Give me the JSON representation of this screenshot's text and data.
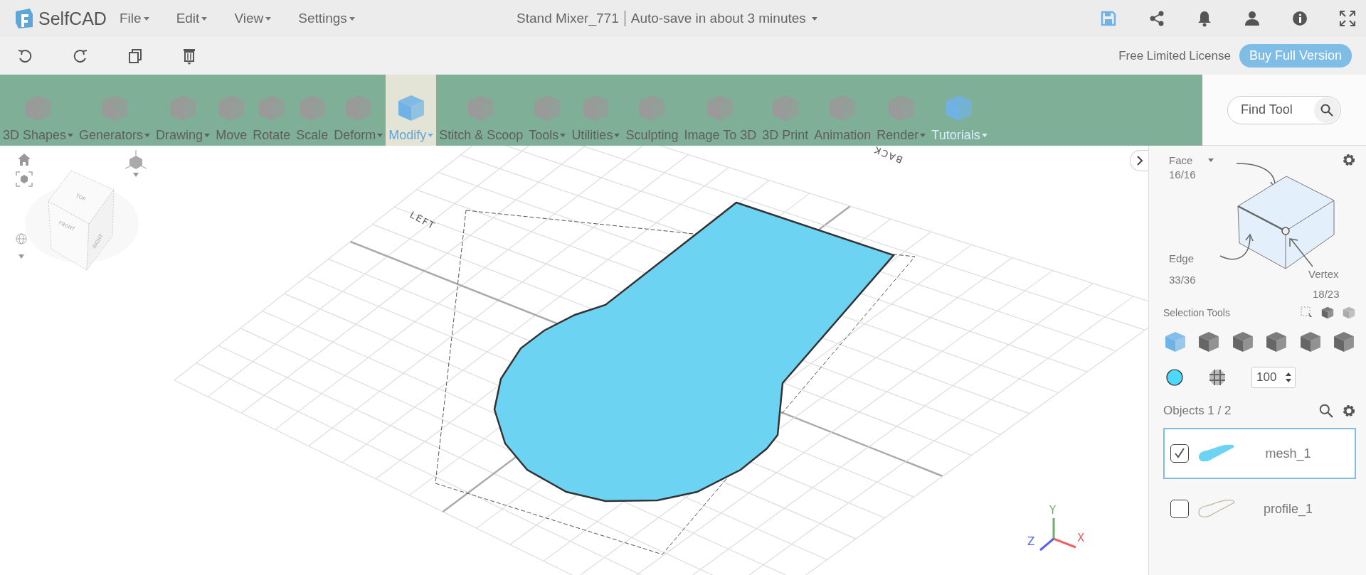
{
  "app": {
    "logo": "SelfCAD",
    "menus": [
      "File",
      "Edit",
      "View",
      "Settings"
    ]
  },
  "document": {
    "title": "Stand Mixer_771",
    "autosave": "Auto-save in about 3 minutes"
  },
  "license": {
    "text": "Free Limited License",
    "button": "Buy Full Version"
  },
  "ribbon": [
    {
      "label": "3D Shapes",
      "dropdown": true,
      "selected": false,
      "kind": "tool"
    },
    {
      "label": "Generators",
      "dropdown": true,
      "selected": false,
      "kind": "tool"
    },
    {
      "label": "Drawing",
      "dropdown": true,
      "selected": false,
      "kind": "tool"
    },
    {
      "label": "Move",
      "dropdown": false,
      "selected": false,
      "kind": "tool"
    },
    {
      "label": "Rotate",
      "dropdown": false,
      "selected": false,
      "kind": "tool"
    },
    {
      "label": "Scale",
      "dropdown": false,
      "selected": false,
      "kind": "tool"
    },
    {
      "label": "Deform",
      "dropdown": true,
      "selected": false,
      "kind": "tool"
    },
    {
      "label": "Modify",
      "dropdown": true,
      "selected": true,
      "kind": "tool"
    },
    {
      "label": "Stitch & Scoop",
      "dropdown": false,
      "selected": false,
      "kind": "tool"
    },
    {
      "label": "Tools",
      "dropdown": true,
      "selected": false,
      "kind": "tool"
    },
    {
      "label": "Utilities",
      "dropdown": true,
      "selected": false,
      "kind": "tool"
    },
    {
      "label": "Sculpting",
      "dropdown": false,
      "selected": false,
      "kind": "tool"
    },
    {
      "label": "Image To 3D",
      "dropdown": false,
      "selected": false,
      "kind": "tool"
    },
    {
      "label": "3D Print",
      "dropdown": false,
      "selected": false,
      "kind": "tool"
    },
    {
      "label": "Animation",
      "dropdown": false,
      "selected": false,
      "kind": "tool"
    },
    {
      "label": "Render",
      "dropdown": true,
      "selected": false,
      "kind": "tool"
    },
    {
      "label": "Tutorials",
      "dropdown": true,
      "selected": false,
      "kind": "link"
    }
  ],
  "find_tool": {
    "placeholder": "Find Tool"
  },
  "viewport": {
    "view_cube": [
      "TOP",
      "FRONT",
      "RIGHT"
    ],
    "grid_labels": [
      "LEFT",
      "BACK"
    ],
    "axes": [
      "Y",
      "Z",
      "X"
    ]
  },
  "panel": {
    "face": {
      "label": "Face",
      "count": "16/16"
    },
    "edge": {
      "label": "Edge",
      "count": "33/36"
    },
    "vertex": {
      "label": "Vertex",
      "count": "18/23"
    },
    "selection_tools": "Selection Tools",
    "selection_modes": [
      {
        "selected": true
      },
      {
        "selected": false
      },
      {
        "selected": false
      },
      {
        "selected": false
      },
      {
        "selected": false
      },
      {
        "selected": false
      }
    ],
    "opacity": "100",
    "objects_title": "Objects 1 / 2",
    "objects": [
      {
        "name": "mesh_1",
        "kind": "mesh",
        "checked": true,
        "selected": true
      },
      {
        "name": "profile_1",
        "kind": "profile",
        "checked": false,
        "selected": false
      }
    ]
  }
}
